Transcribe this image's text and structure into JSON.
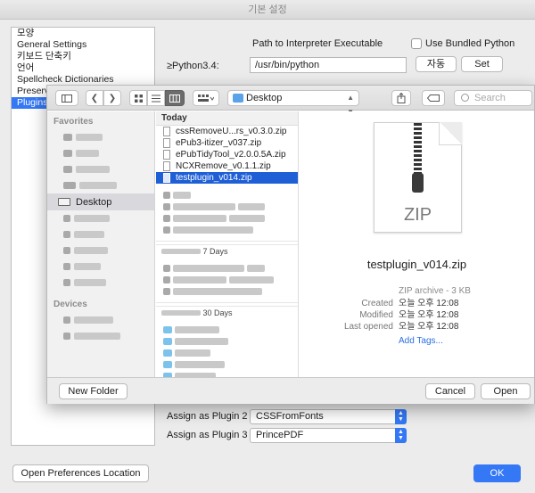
{
  "window": {
    "title": "기본 설정"
  },
  "pref_list": {
    "items": [
      "모양",
      "General Settings",
      "키보드 단축키",
      "언어",
      "Spellcheck Dictionaries",
      "Preserv",
      "Plugins"
    ],
    "selected_index": 6
  },
  "interpreter": {
    "header_label": "Path to Interpreter Executable",
    "bundled_label": "Use Bundled Python",
    "bundled_checked": false,
    "python_label": "≥Python3.4:",
    "path_value": "/usr/bin/python",
    "auto_label": "자동",
    "set_label": "Set"
  },
  "assign": [
    {
      "label": "Assign as Plugin 2",
      "value": "CSSFromFonts"
    },
    {
      "label": "Assign as Plugin 3",
      "value": "PrincePDF"
    }
  ],
  "open_pref_location_label": "Open Preferences Location",
  "ok_label": "OK",
  "panel": {
    "location": "Desktop",
    "search_placeholder": "Search",
    "sidebar": {
      "favorites_heading": "Favorites",
      "selected_item": "Desktop",
      "devices_heading": "Devices"
    },
    "column": {
      "today_heading": "Today",
      "files": [
        "cssRemoveU...rs_v0.3.0.zip",
        "ePub3-itizer_v037.zip",
        "ePubTidyTool_v2.0.0.5A.zip",
        "NCXRemove_v0.1.1.zip",
        "testplugin_v014.zip"
      ],
      "selected_index": 4,
      "section_days": "7 Days",
      "section_30days": "30 Days"
    },
    "preview": {
      "icon_text": "ZIP",
      "file_name": "testplugin_v014.zip",
      "kind": "ZIP archive - 3 KB",
      "created_label": "Created",
      "created_value": "오늘 오후 12:08",
      "modified_label": "Modified",
      "modified_value": "오늘 오후 12:08",
      "opened_label": "Last opened",
      "opened_value": "오늘 오후 12:08",
      "add_tags": "Add Tags..."
    },
    "new_folder_label": "New Folder",
    "cancel_label": "Cancel",
    "open_label": "Open"
  },
  "colors": {
    "accent": "#3478f6",
    "selection": "#1f5fd6"
  }
}
